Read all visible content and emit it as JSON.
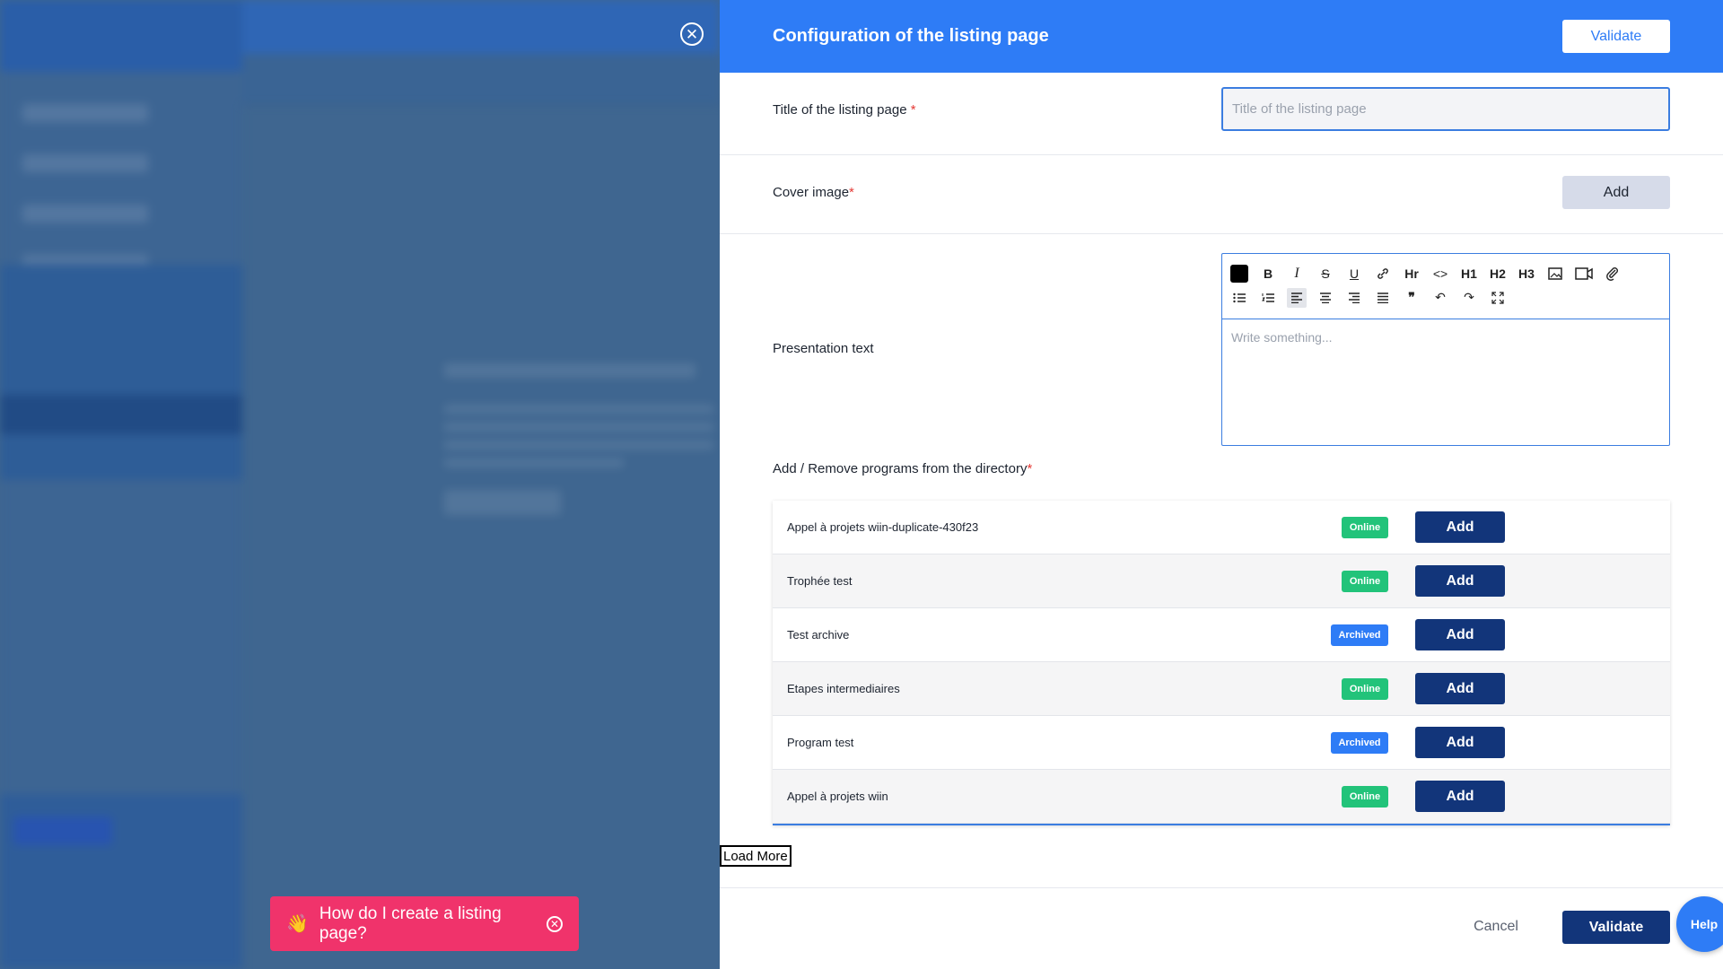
{
  "drawer": {
    "title": "Configuration of the listing page",
    "validate_top_label": "Validate",
    "title_field": {
      "label": "Title of the listing page",
      "required_mark": "*",
      "placeholder": "Title of the listing page",
      "value": ""
    },
    "cover_field": {
      "label": "Cover image",
      "required_mark": "*",
      "add_label": "Add"
    },
    "presentation_field": {
      "label": "Presentation text",
      "placeholder": "Write something..."
    },
    "toolbar": {
      "row1": [
        "color-swatch",
        "B",
        "I",
        "S",
        "U",
        "link",
        "Hr",
        "<>",
        "H1",
        "H2",
        "H3",
        "image",
        "video",
        "attachment"
      ],
      "row2": [
        "bullet-list",
        "ordered-list",
        "align-left",
        "align-center",
        "align-right",
        "justify",
        "quote",
        "undo",
        "redo",
        "fullscreen"
      ]
    },
    "programs": {
      "label": "Add / Remove programs from the directory",
      "required_mark": "*",
      "items": [
        {
          "name": "Appel à projets wiin-duplicate-430f23",
          "status": "Online",
          "action": "Add"
        },
        {
          "name": "Trophée test",
          "status": "Online",
          "action": "Add"
        },
        {
          "name": "Test archive",
          "status": "Archived",
          "action": "Add"
        },
        {
          "name": "Etapes intermediaires",
          "status": "Online",
          "action": "Add"
        },
        {
          "name": "Program test",
          "status": "Archived",
          "action": "Add"
        },
        {
          "name": "Appel à projets wiin",
          "status": "Online",
          "action": "Add"
        }
      ],
      "load_more_label": "Load More"
    },
    "footer": {
      "cancel_label": "Cancel",
      "validate_label": "Validate"
    }
  },
  "toast": {
    "emoji": "👋",
    "text": "How do I create a listing page?"
  },
  "help_bubble": {
    "label": "Help"
  },
  "colors": {
    "header": "#2e7cf6",
    "primary_dark": "#12357a",
    "online": "#22c37a",
    "archived": "#2e7cf6",
    "toast": "#f0336b"
  }
}
